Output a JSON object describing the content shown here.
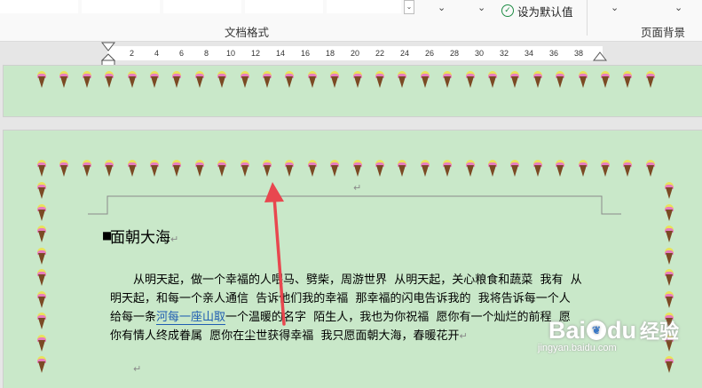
{
  "ribbon": {
    "group_label": "文档格式",
    "set_default_label": "设为默认值",
    "page_bg_label": "页面背景",
    "accent": "#1e8c45"
  },
  "ruler": {
    "labels": [
      "2",
      "4",
      "6",
      "8",
      "10",
      "12",
      "14",
      "16",
      "18",
      "20",
      "22",
      "24",
      "26",
      "28",
      "30",
      "32",
      "34",
      "36",
      "38"
    ]
  },
  "document": {
    "title": "面朝大海",
    "lines": [
      {
        "parts": [
          {
            "text": "从明天起，做一个幸福的人喂马、劈柴，周游世界  从明天起，关心粮食和蔬菜  我有  从"
          }
        ]
      },
      {
        "parts": [
          {
            "text": "明天起，和每一个亲人通信  告诉他们我的幸福  那幸福的闪电告诉我的  我将告诉每一个人"
          }
        ]
      },
      {
        "parts": [
          {
            "text": "给每一条"
          },
          {
            "text": "河每一座山取",
            "link": true
          },
          {
            "text": "一个温暖的名字  陌生人，我也为你祝福  愿你有一个灿烂的前程  愿"
          }
        ]
      },
      {
        "parts": [
          {
            "text": "你有情人终成眷属  愿你在尘世获得幸福  我只愿面朝大海，春暖花开"
          }
        ]
      }
    ],
    "paragraph_mark": "↵"
  },
  "watermark": {
    "brand": "Bai",
    "brand2": "du",
    "brand_cn": "经验",
    "url": "jingyan.baidu.com"
  },
  "colors": {
    "page_bg": "#c9e8c9",
    "arrow": "#e8474f",
    "cone_yellow": "#e9e25a",
    "cone_pink": "#e77cc0",
    "cone_body": "#7b4a24"
  }
}
